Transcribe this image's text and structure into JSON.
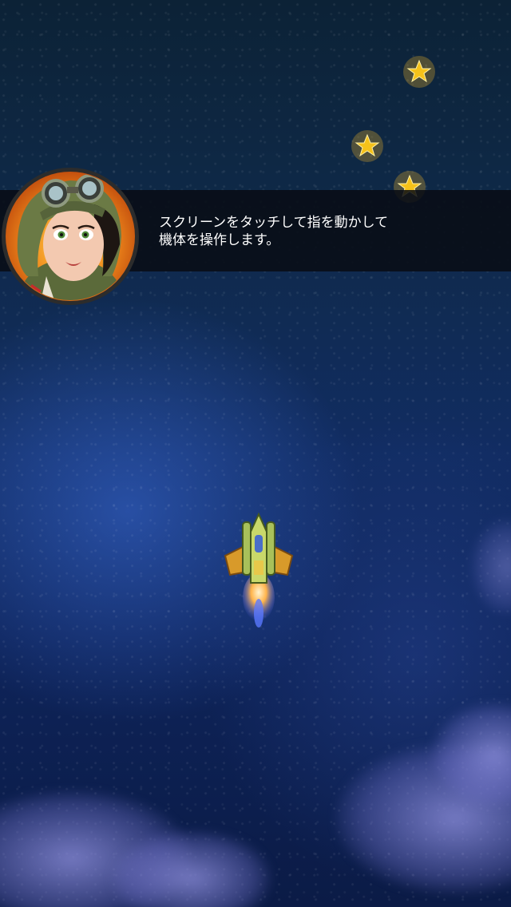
{
  "scene": {
    "type": "vertical-shooter-tutorial",
    "background": "night sea from above"
  },
  "colors": {
    "banner_bg": "#080c14",
    "text": "#ffffff",
    "star": "#f5c21a",
    "avatar_ring": "#e8731a"
  },
  "dialog": {
    "speaker_icon": "pilot-portrait-icon",
    "line1": "スクリーンをタッチして指を動かして",
    "line2": "機体を操作します。"
  },
  "pickups": {
    "icon": "star-icon",
    "count_visible": 3
  },
  "player": {
    "icon": "fighter-jet-icon"
  }
}
